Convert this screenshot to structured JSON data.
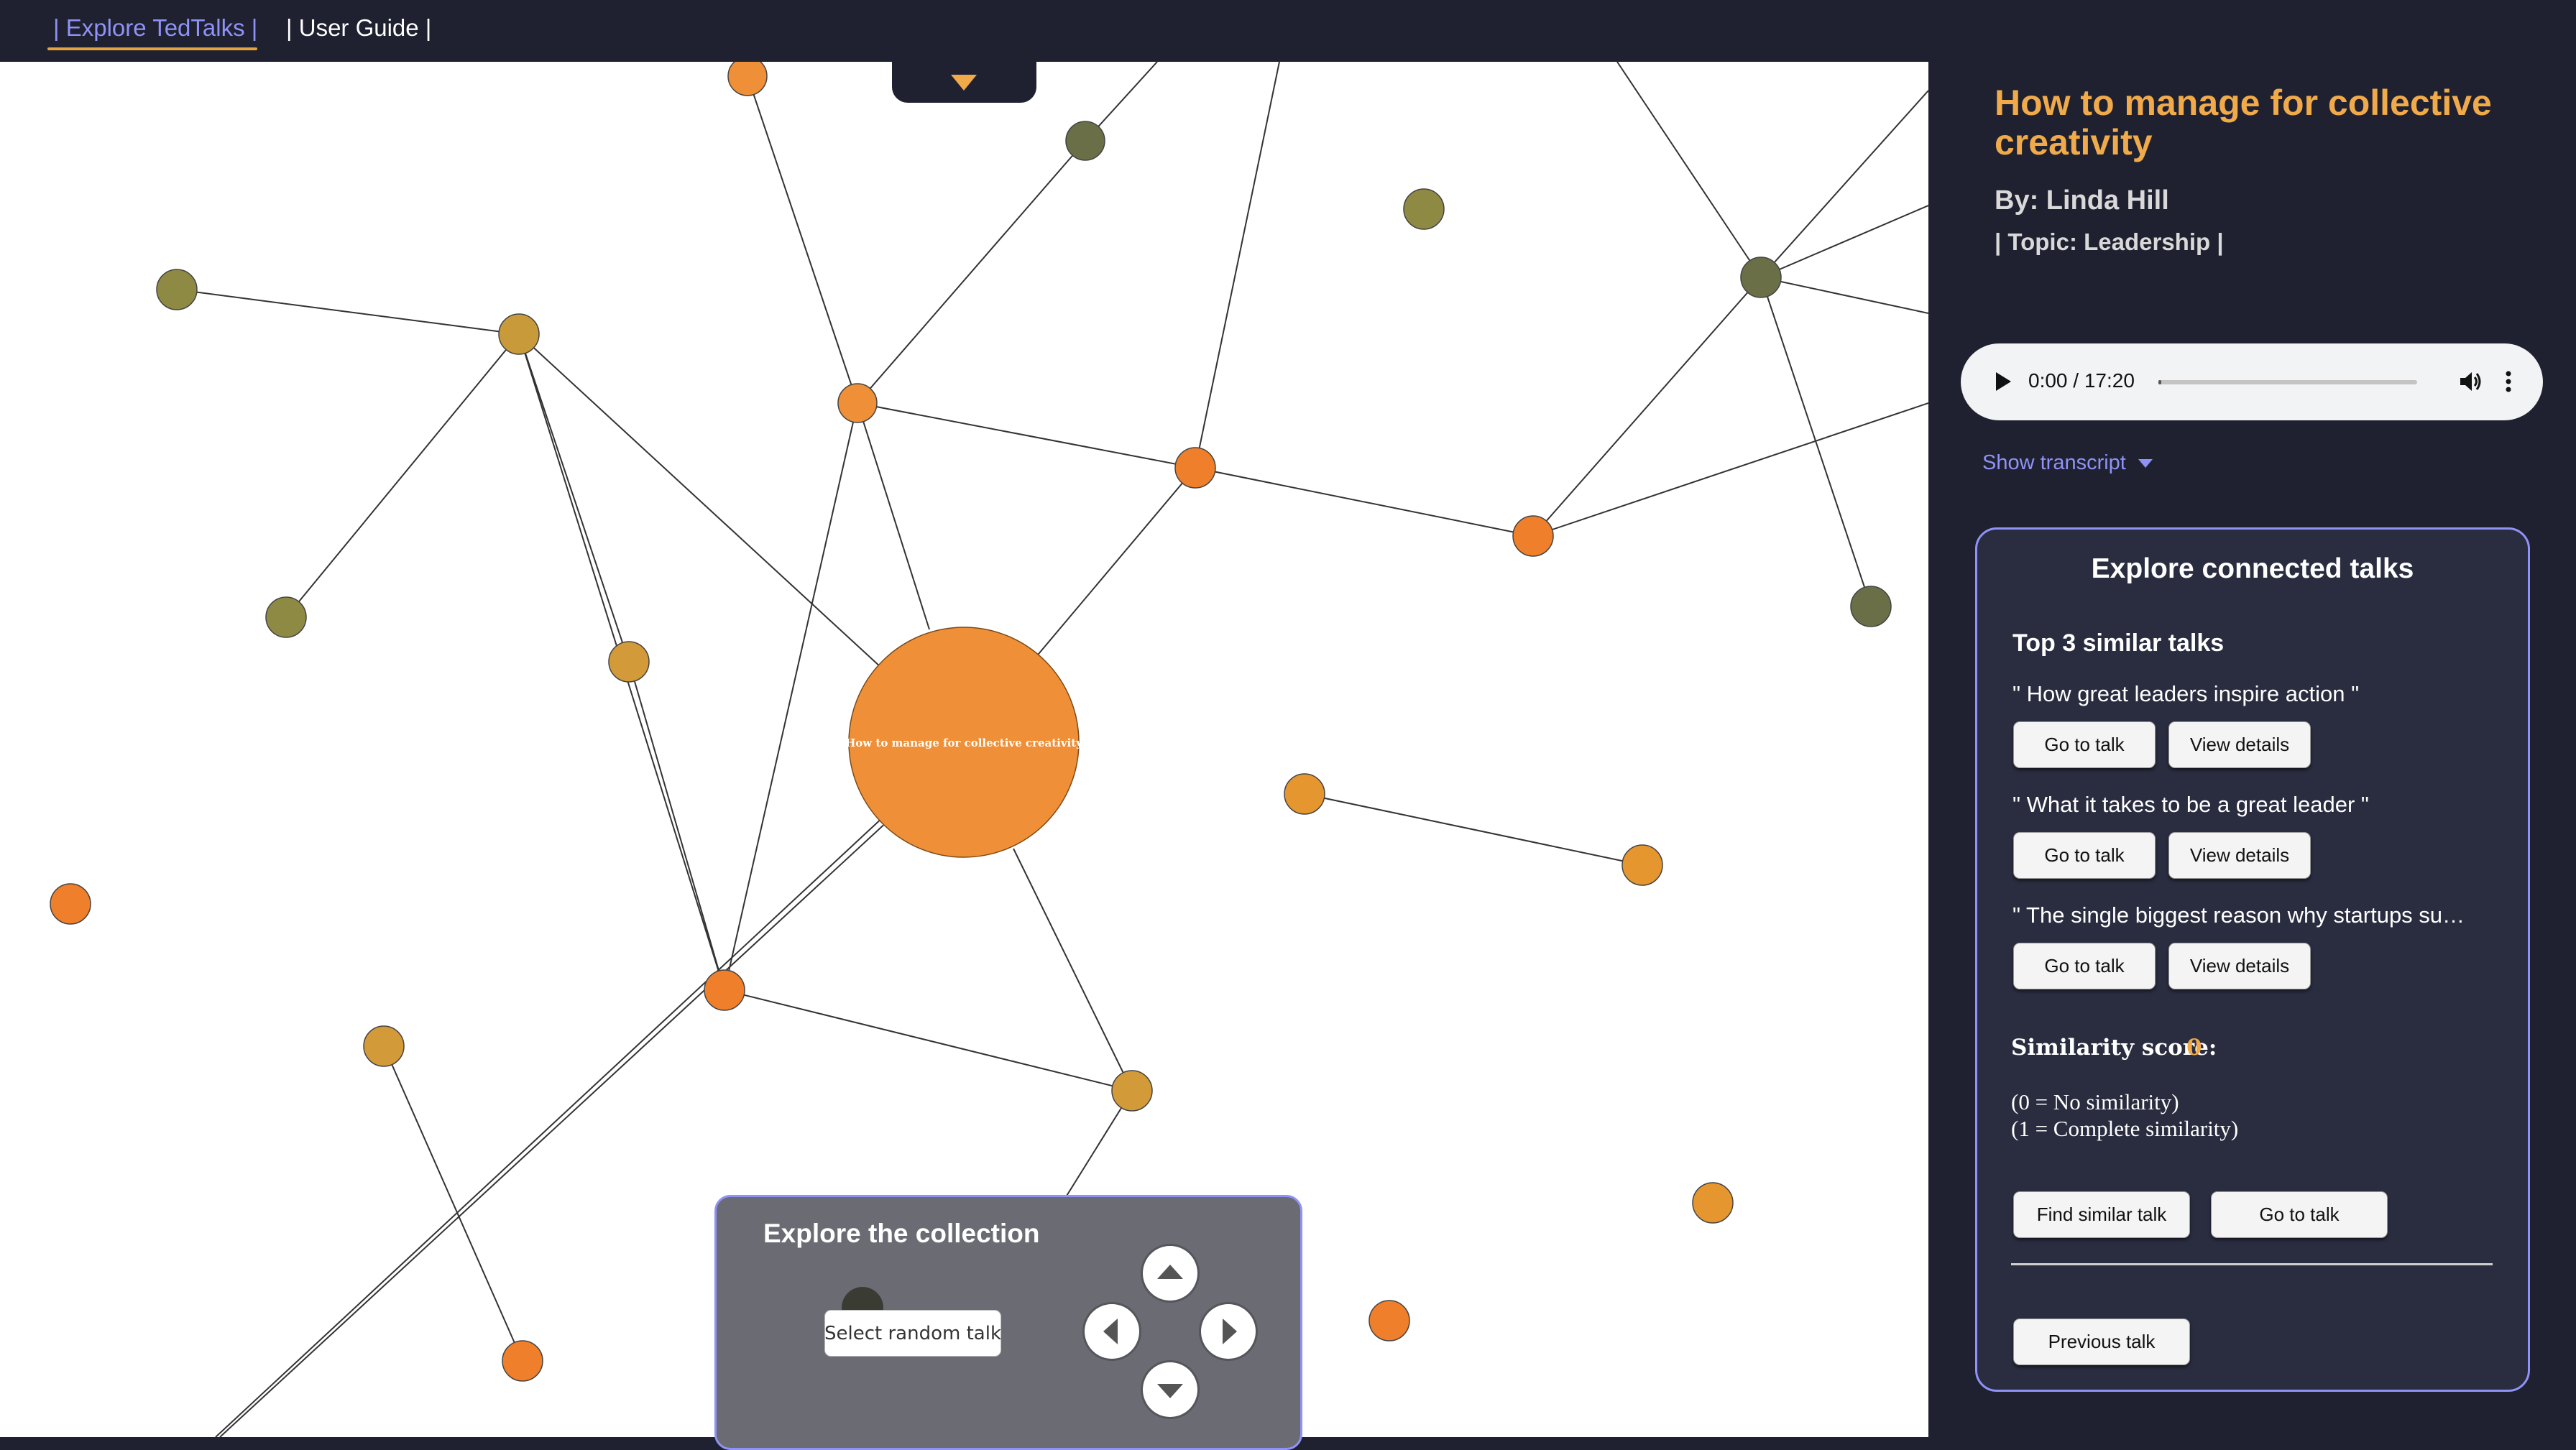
{
  "nav": {
    "explore": "| Explore TedTalks |",
    "guide": "| User Guide |"
  },
  "graph": {
    "center_label": "How to manage for collective creativity",
    "colors": {
      "orange": "#ef8f37",
      "orange_dark": "#f07f2b",
      "gold": "#d39a3a",
      "olive": "#8f8a43",
      "dark_olive": "#6a6f48"
    }
  },
  "explore_collection": {
    "title": "Explore the collection",
    "random_button": "Select random talk",
    "arrows": [
      "up-arrow-icon",
      "left-arrow-icon",
      "right-arrow-icon",
      "down-arrow-icon"
    ]
  },
  "talk": {
    "title": "How to manage for collective creativity",
    "author": "By: Linda Hill",
    "topic": "| Topic: Leadership |"
  },
  "audio": {
    "time": "0:00 / 17:20",
    "progress": 0.0
  },
  "transcript_toggle": "Show transcript",
  "connected": {
    "heading": "Explore connected talks",
    "top3_label": "Top 3 similar talks",
    "similar": [
      {
        "title": "\" How great leaders inspire action \"",
        "go": "Go to talk",
        "details": "View details"
      },
      {
        "title": "\" What it takes to be a great leader \"",
        "go": "Go to talk",
        "details": "View details"
      },
      {
        "title": "\" The single biggest reason why startups succeed \"",
        "go": "Go to talk",
        "details": "View details"
      }
    ],
    "score_label": "Similarity score:",
    "score_value": "0",
    "legend_0": "(0 = No similarity)",
    "legend_1": "(1 = Complete similarity)",
    "find_similar": "Find similar talk",
    "go_to_talk": "Go to talk",
    "previous": "Previous talk"
  },
  "accent": "#8f92f6",
  "highlight": "#f0aa4a"
}
